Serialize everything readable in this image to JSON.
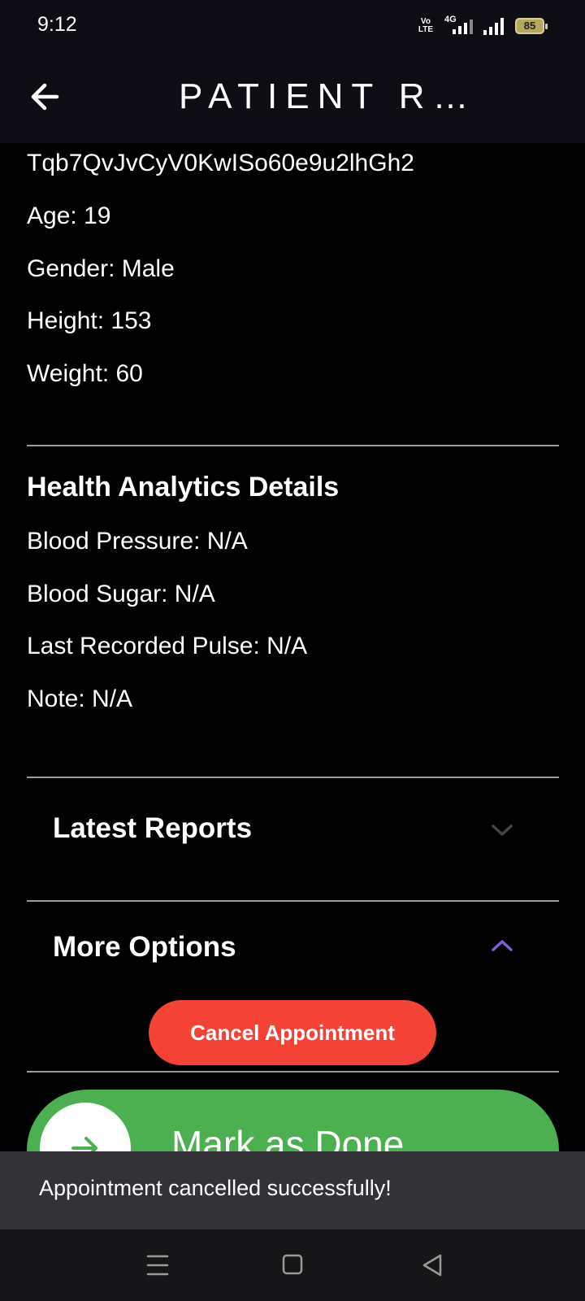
{
  "status_bar": {
    "time": "9:12",
    "volte_label": "Vo LTE",
    "network_label": "4G",
    "battery": "85"
  },
  "app_bar": {
    "title": "PATIENT R…"
  },
  "patient": {
    "id_line": "Tqb7QvJvCyV0KwISo60e9u2lhGh2",
    "age": "Age: 19",
    "gender": "Gender: Male",
    "height": "Height: 153",
    "weight": "Weight: 60"
  },
  "health": {
    "title": "Health Analytics Details",
    "blood_pressure": "Blood Pressure: N/A",
    "blood_sugar": "Blood Sugar: N/A",
    "pulse": "Last Recorded Pulse: N/A",
    "note": "Note: N/A"
  },
  "sections": {
    "latest_reports": "Latest Reports",
    "more_options": "More Options"
  },
  "actions": {
    "cancel_appointment": "Cancel Appointment",
    "mark_done": "Mark as Done"
  },
  "snackbar": {
    "message": "Appointment cancelled successfully!"
  },
  "colors": {
    "danger": "#f44336",
    "success": "#4caf50",
    "accent": "#7b5fd6"
  }
}
